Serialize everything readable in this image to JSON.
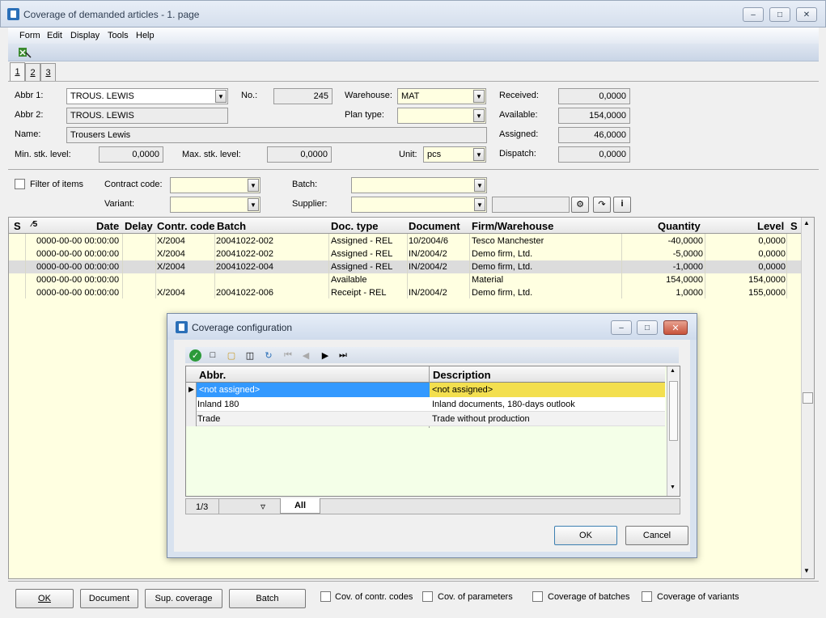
{
  "window": {
    "title": "Coverage of demanded articles - 1. page"
  },
  "menu": [
    "Form",
    "Edit",
    "Display",
    "Tools",
    "Help"
  ],
  "tabs": [
    "1",
    "2",
    "3"
  ],
  "form": {
    "abbr1_label": "Abbr 1:",
    "abbr1_value": "TROUS. LEWIS",
    "no_label": "No.:",
    "no_value": "245",
    "warehouse_label": "Warehouse:",
    "warehouse_value": "MAT",
    "received_label": "Received:",
    "received_value": "0,0000",
    "abbr2_label": "Abbr 2:",
    "abbr2_value": "TROUS. LEWIS",
    "plan_type_label": "Plan type:",
    "plan_type_value": "",
    "available_label": "Available:",
    "available_value": "154,0000",
    "name_label": "Name:",
    "name_value": "Trousers Lewis",
    "assigned_label": "Assigned:",
    "assigned_value": "46,0000",
    "min_label": "Min. stk. level:",
    "min_value": "0,0000",
    "max_label": "Max. stk. level:",
    "max_value": "0,0000",
    "unit_label": "Unit:",
    "unit_value": "pcs",
    "dispatch_label": "Dispatch:",
    "dispatch_value": "0,0000"
  },
  "filter": {
    "filter_items_label": "Filter of items",
    "contract_label": "Contract code:",
    "batch_label": "Batch:",
    "variant_label": "Variant:",
    "supplier_label": "Supplier:"
  },
  "grid": {
    "columns": [
      "S",
      "⁄5",
      "Date",
      "Delay",
      "Contr. code",
      "Batch",
      "Doc. type",
      "Document",
      "Firm/Warehouse",
      "Quantity",
      "Level",
      "S"
    ],
    "rows": [
      {
        "date": "0000-00-00 00:00:00",
        "contr": "X/2004",
        "batch": "20041022-002",
        "doctype": "Assigned - REL",
        "document": "10/2004/6",
        "firm": "Tesco Manchester",
        "qty": "-40,0000",
        "level": "0,0000"
      },
      {
        "date": "0000-00-00 00:00:00",
        "contr": "X/2004",
        "batch": "20041022-002",
        "doctype": "Assigned - REL",
        "document": "IN/2004/2",
        "firm": "Demo firm, Ltd.",
        "qty": "-5,0000",
        "level": "0,0000"
      },
      {
        "date": "0000-00-00 00:00:00",
        "contr": "X/2004",
        "batch": "20041022-004",
        "doctype": "Assigned - REL",
        "document": "IN/2004/2",
        "firm": "Demo firm, Ltd.",
        "qty": "-1,0000",
        "level": "0,0000"
      },
      {
        "date": "0000-00-00 00:00:00",
        "contr": "",
        "batch": "",
        "doctype": "Available",
        "document": "",
        "firm": "Material",
        "qty": "154,0000",
        "level": "154,0000"
      },
      {
        "date": "0000-00-00 00:00:00",
        "contr": "X/2004",
        "batch": "20041022-006",
        "doctype": "Receipt - REL",
        "document": "IN/2004/2",
        "firm": "Demo firm, Ltd.",
        "qty": "1,0000",
        "level": "155,0000"
      }
    ]
  },
  "bottom": {
    "ok": "OK",
    "document": "Document",
    "sup_coverage": "Sup. coverage",
    "batch": "Batch",
    "cov_contr": "Cov. of contr. codes",
    "cov_params": "Cov. of parameters",
    "cov_batches": "Coverage of batches",
    "cov_variants": "Coverage of variants"
  },
  "dialog": {
    "title": "Coverage configuration",
    "columns": [
      "Abbr.",
      "Description"
    ],
    "rows": [
      {
        "abbr": "<not assigned>",
        "desc": "<not assigned>"
      },
      {
        "abbr": "Inland 180",
        "desc": "Inland documents, 180-days outlook"
      },
      {
        "abbr": "Trade",
        "desc": "Trade without production"
      }
    ],
    "record_count": "1/3",
    "filter_tab": "All",
    "ok": "OK",
    "cancel": "Cancel"
  },
  "colors": {
    "grid_bg": "#ffffe1",
    "selection": "#3399ff",
    "highlight": "#f3df4f",
    "accent": "#2a6fb8"
  }
}
